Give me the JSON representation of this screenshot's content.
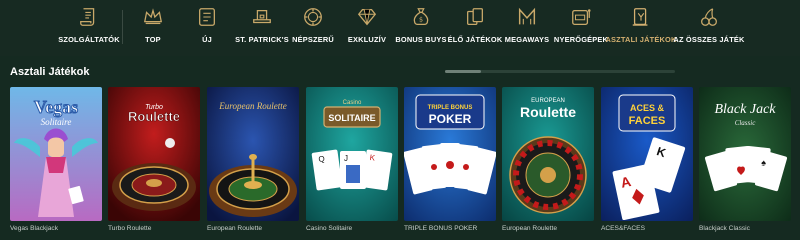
{
  "nav": {
    "items": [
      {
        "label": "SZOLGÁLTATÓK",
        "icon": "scroll-icon",
        "active": false
      },
      {
        "label": "TOP",
        "icon": "crown-icon",
        "active": false
      },
      {
        "label": "ÚJ",
        "icon": "new-badge-icon",
        "active": false
      },
      {
        "label": "ST. PATRICK'S",
        "icon": "leprechaun-hat-icon",
        "active": false
      },
      {
        "label": "NÉPSZERŰ",
        "icon": "chip-icon",
        "active": false
      },
      {
        "label": "EXKLUZÍV",
        "icon": "diamond-icon",
        "active": false
      },
      {
        "label": "BONUS BUYS",
        "icon": "money-bag-icon",
        "active": false
      },
      {
        "label": "ÉLŐ JÁTÉKOK",
        "icon": "live-cards-icon",
        "active": false
      },
      {
        "label": "MEGAWAYS",
        "icon": "megaways-icon",
        "active": false
      },
      {
        "label": "NYERŐGÉPEK",
        "icon": "slot-machine-icon",
        "active": false
      },
      {
        "label": "ASZTALI JÁTÉKOK",
        "icon": "table-games-icon",
        "active": true
      },
      {
        "label": "AZ ÖSSZES JÁTÉK",
        "icon": "cherries-icon",
        "active": false
      }
    ]
  },
  "section": {
    "title": "Asztali Játékok"
  },
  "games": [
    {
      "name": "Vegas Blackjack",
      "art_title": "Vegas",
      "art_subtitle": "Solitaire"
    },
    {
      "name": "Turbo Roulette",
      "art_title": "Roulette",
      "art_subtitle": "Turbo"
    },
    {
      "name": "European Roulette",
      "art_title": "European Roulette",
      "art_subtitle": ""
    },
    {
      "name": "Casino Solitaire",
      "art_title": "SOLITAIRE",
      "art_subtitle": "Casino"
    },
    {
      "name": "TRIPLE BONUS POKER",
      "art_title": "POKER",
      "art_subtitle": "TRIPLE BONUS"
    },
    {
      "name": "European Roulette",
      "art_title": "Roulette",
      "art_subtitle": "EUROPEAN"
    },
    {
      "name": "ACES&FACES",
      "art_title": "FACES",
      "art_subtitle": "ACES &"
    },
    {
      "name": "Blackjack Classic",
      "art_title": "Black Jack",
      "art_subtitle": "Classic"
    }
  ],
  "colors": {
    "accent": "#d4b071",
    "background": "#13251d",
    "navbar": "#172a22"
  }
}
